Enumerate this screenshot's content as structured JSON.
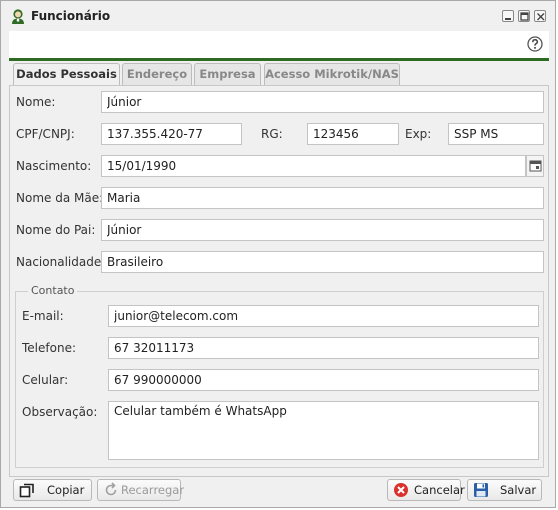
{
  "window": {
    "title": "Funcionário"
  },
  "tabs": [
    {
      "label": "Dados Pessoais",
      "active": true
    },
    {
      "label": "Endereço",
      "active": false
    },
    {
      "label": "Empresa",
      "active": false
    },
    {
      "label": "Acesso Mikrotik/NAS",
      "active": false
    }
  ],
  "personal": {
    "nome": {
      "label": "Nome:",
      "value": "Júnior"
    },
    "cpf": {
      "label": "CPF/CNPJ:",
      "value": "137.355.420-77"
    },
    "rg": {
      "label": "RG:",
      "value": "123456"
    },
    "exp": {
      "label": "Exp:",
      "value": "SSP MS"
    },
    "nascimento": {
      "label": "Nascimento:",
      "value": "15/01/1990"
    },
    "mae": {
      "label": "Nome da Mãe:",
      "value": "Maria"
    },
    "pai": {
      "label": "Nome do Pai:",
      "value": "Júnior"
    },
    "nacionalidade": {
      "label": "Nacionalidade:",
      "value": "Brasileiro"
    }
  },
  "contato": {
    "legend": "Contato",
    "email": {
      "label": "E-mail:",
      "value": "junior@telecom.com"
    },
    "telefone": {
      "label": "Telefone:",
      "value": "67 32011173"
    },
    "celular": {
      "label": "Celular:",
      "value": "67 990000000"
    },
    "observacao": {
      "label": "Observação:",
      "value": "Celular também é WhatsApp"
    }
  },
  "buttons": {
    "copiar": "Copiar",
    "recarregar": "Recarregar",
    "cancelar": "Cancelar",
    "salvar": "Salvar"
  },
  "icons": {
    "title": "employee-icon",
    "help": "help-icon",
    "minimize": "minimize-icon",
    "maximize": "maximize-icon",
    "close": "close-icon",
    "calendar": "calendar-icon",
    "copiar": "copy-icon",
    "recarregar": "reload-icon",
    "cancelar": "cancel-icon",
    "salvar": "save-icon"
  },
  "colors": {
    "accent": "#2d6a22",
    "cancel": "#d9312b",
    "save": "#2a5fa8"
  }
}
